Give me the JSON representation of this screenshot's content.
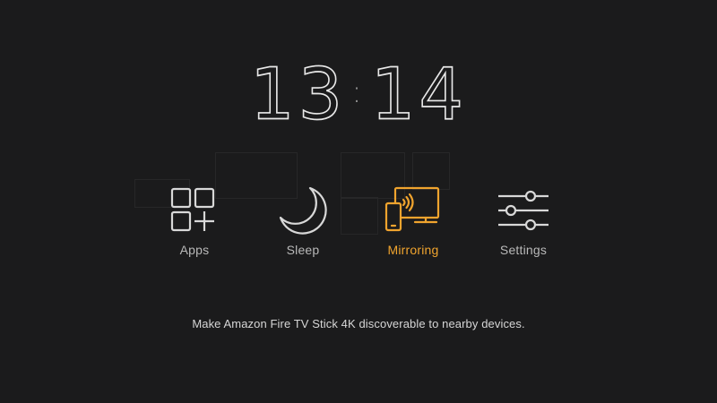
{
  "clock": {
    "hours": "13",
    "separator": ":",
    "minutes": "14"
  },
  "menu": {
    "items": [
      {
        "label": "Apps",
        "icon": "apps-grid-icon"
      },
      {
        "label": "Sleep",
        "icon": "moon-icon"
      },
      {
        "label": "Mirroring",
        "icon": "mirroring-icon",
        "selected": true
      },
      {
        "label": "Settings",
        "icon": "sliders-icon"
      }
    ]
  },
  "hint": {
    "text": "Make Amazon Fire TV Stick 4K discoverable to nearby devices."
  },
  "colors": {
    "background": "#1b1b1c",
    "accent": "#f0a42e",
    "icon": "#d8d8d8",
    "label": "#b9b9b9"
  }
}
